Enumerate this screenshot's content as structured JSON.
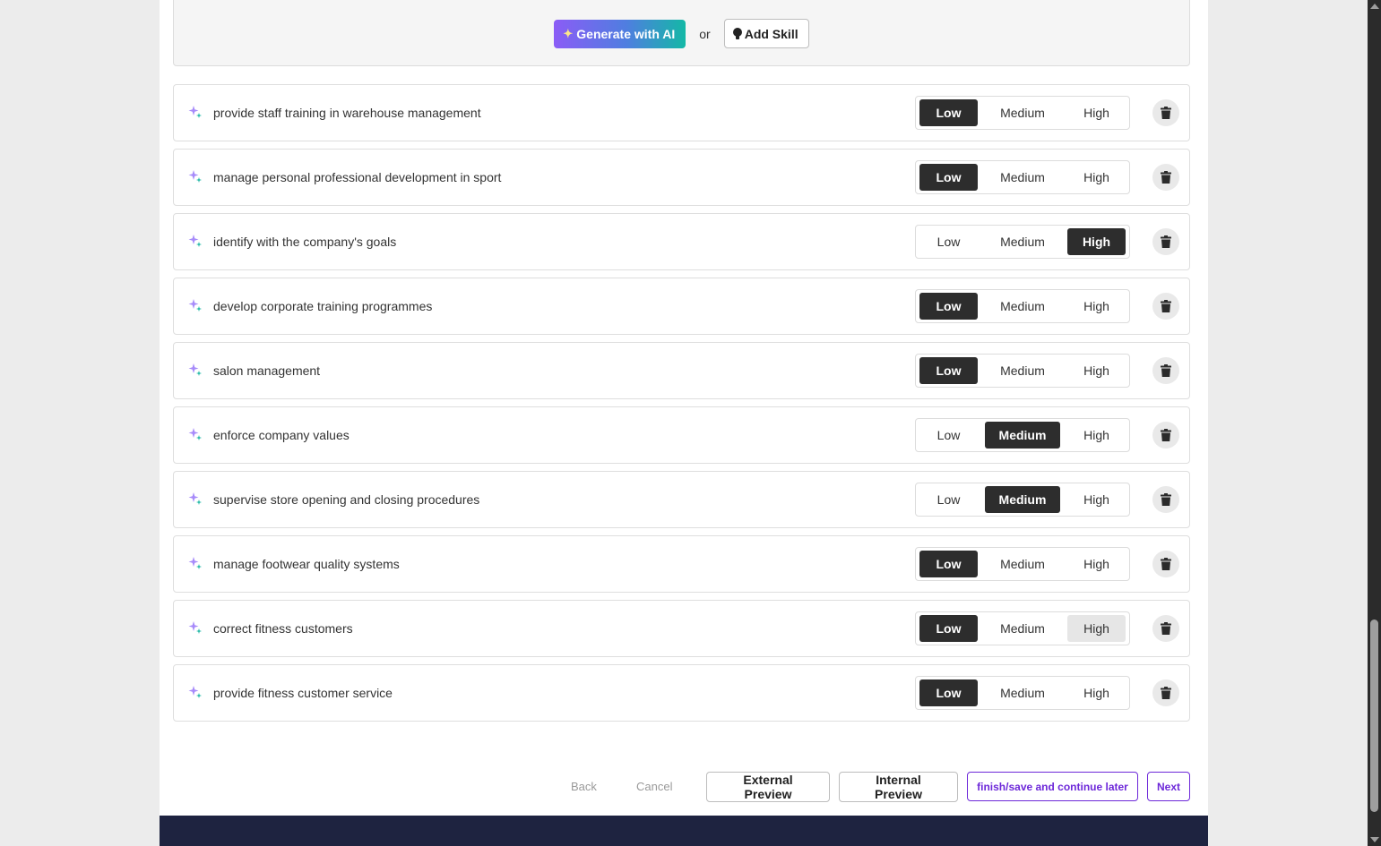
{
  "generator": {
    "ai_button_label": "Generate with AI",
    "or_text": "or",
    "add_skill_label": "Add Skill"
  },
  "level_options": {
    "low": "Low",
    "medium": "Medium",
    "high": "High"
  },
  "skills": [
    {
      "label": "provide staff training in warehouse management",
      "level": "Low"
    },
    {
      "label": "manage personal professional development in sport",
      "level": "Low"
    },
    {
      "label": "identify with the company's goals",
      "level": "High"
    },
    {
      "label": "develop corporate training programmes",
      "level": "Low"
    },
    {
      "label": "salon management",
      "level": "Low"
    },
    {
      "label": "enforce company values",
      "level": "Medium"
    },
    {
      "label": "supervise store opening and closing procedures",
      "level": "Medium"
    },
    {
      "label": "manage footwear quality systems",
      "level": "Low"
    },
    {
      "label": "correct fitness customers",
      "level": "Low",
      "hovered": "High"
    },
    {
      "label": "provide fitness customer service",
      "level": "Low"
    }
  ],
  "actions": {
    "back": "Back",
    "cancel": "Cancel",
    "external_preview": "External Preview",
    "internal_preview": "Internal Preview",
    "finish_later": "finish/save and continue later",
    "next": "Next"
  },
  "colors": {
    "active_segment": "#2d2d2d",
    "accent_purple": "#6d28d9",
    "footer_bg": "#1e2340"
  }
}
